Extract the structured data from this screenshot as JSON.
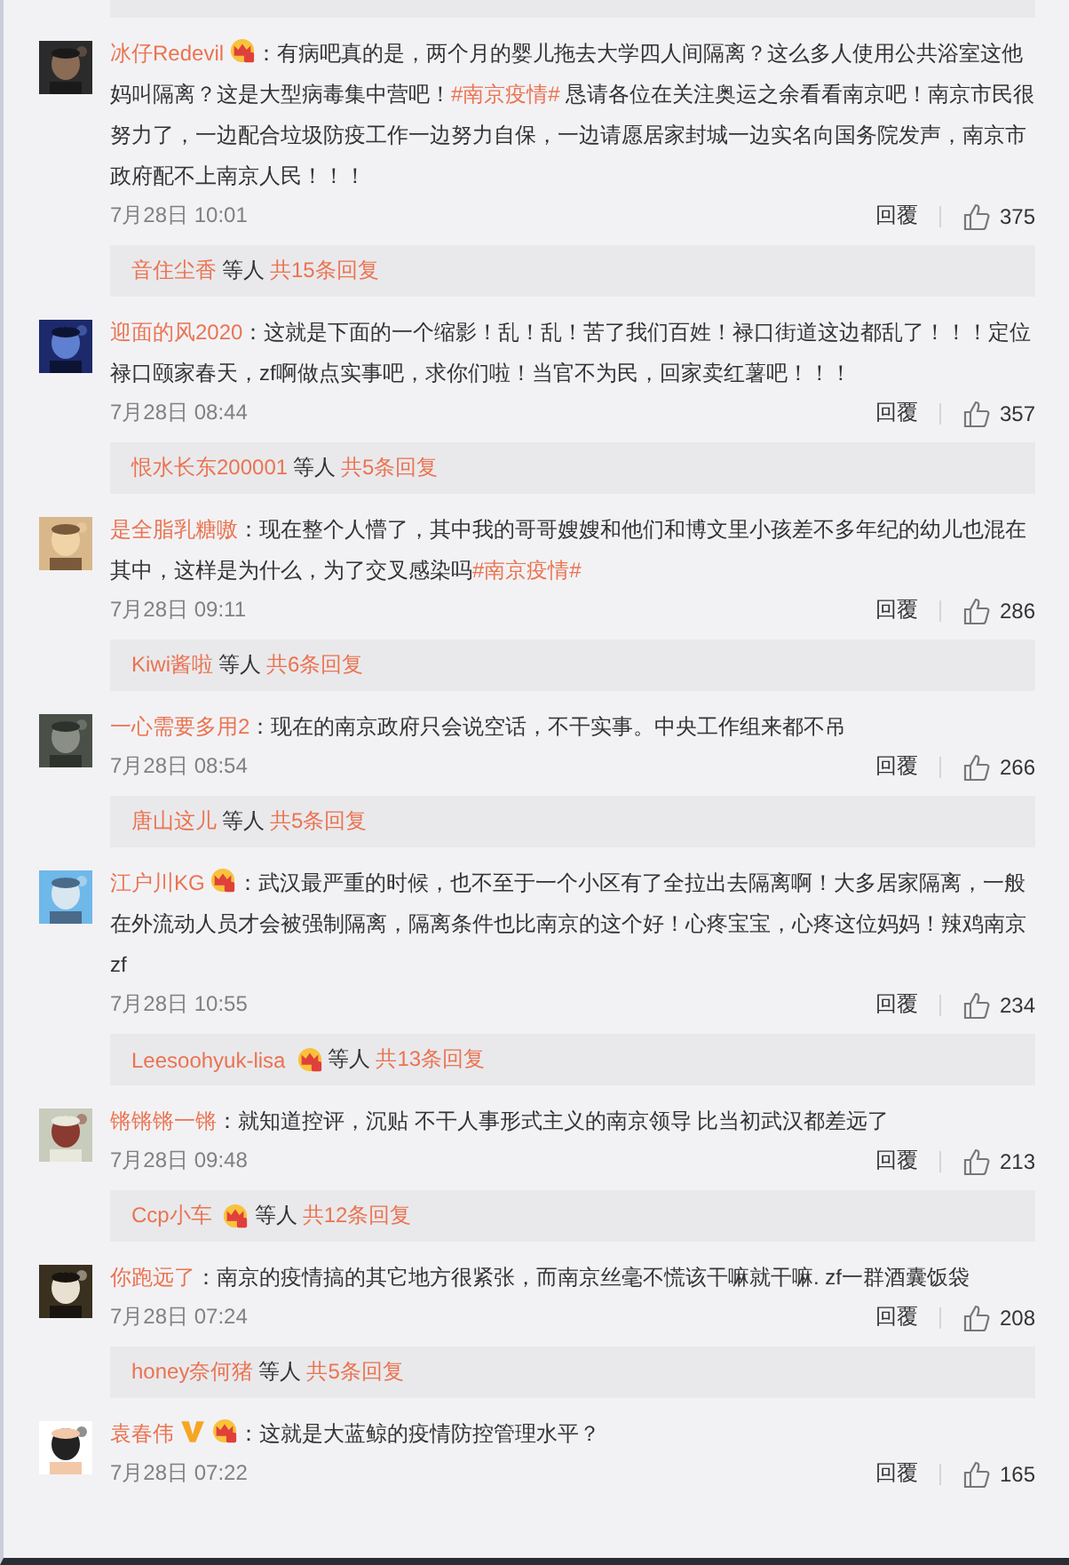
{
  "comments": [
    {
      "user": "冰仔Redevil",
      "member": true,
      "content": [
        {
          "kind": "plain",
          "text": "：有病吧真的是，两个月的婴儿拖去大学四人间隔离？这么多人使用公共浴室这他妈叫隔离？这是大型病毒集中营吧！"
        },
        {
          "kind": "topic",
          "text": "#南京疫情#"
        },
        {
          "kind": "plain",
          "text": " 恳请各位在关注奥运之余看看南京吧！南京市民很努力了，一边配合垃圾防疫工作一边努力自保，一边请愿居家封城一边实名向国务院发声，南京市政府配不上南京人民！！！"
        }
      ],
      "time": "7月28日 10:01",
      "reply_label": "回覆",
      "likes": "375",
      "replies": {
        "user": "音住尘香",
        "middle": "等人",
        "count": "共15条回复"
      }
    },
    {
      "user": "迎面的风2020",
      "content": [
        {
          "kind": "plain",
          "text": "：这就是下面的一个缩影！乱！乱！苦了我们百姓！禄口街道这边都乱了！！！定位禄口颐家春天，zf啊做点实事吧，求你们啦！当官不为民，回家卖红薯吧！！！"
        }
      ],
      "time": "7月28日 08:44",
      "reply_label": "回覆",
      "likes": "357",
      "replies": {
        "user": "恨水长东200001",
        "middle": "等人",
        "count": "共5条回复"
      }
    },
    {
      "user": "是全脂乳糖嗷",
      "content": [
        {
          "kind": "plain",
          "text": "：现在整个人懵了，其中我的哥哥嫂嫂和他们和博文里小孩差不多年纪的幼儿也混在其中，这样是为什么，为了交叉感染吗"
        },
        {
          "kind": "topic",
          "text": "#南京疫情#"
        }
      ],
      "time": "7月28日 09:11",
      "reply_label": "回覆",
      "likes": "286",
      "replies": {
        "user": "Kiwi酱啦",
        "middle": "等人",
        "count": "共6条回复"
      }
    },
    {
      "user": "一心需要多用2",
      "content": [
        {
          "kind": "plain",
          "text": "：现在的南京政府只会说空话，不干实事。中央工作组来都不吊"
        }
      ],
      "time": "7月28日 08:54",
      "reply_label": "回覆",
      "likes": "266",
      "replies": {
        "user": "唐山这儿",
        "middle": "等人",
        "count": "共5条回复"
      }
    },
    {
      "user": "江户川KG",
      "member": true,
      "content": [
        {
          "kind": "plain",
          "text": "：武汉最严重的时候，也不至于一个小区有了全拉出去隔离啊！大多居家隔离，一般在外流动人员才会被强制隔离，隔离条件也比南京的这个好！心疼宝宝，心疼这位妈妈！辣鸡南京zf"
        }
      ],
      "time": "7月28日 10:55",
      "reply_label": "回覆",
      "likes": "234",
      "replies": {
        "user": "Leesoohyuk-lisa",
        "member": true,
        "middle": "等人",
        "count": "共13条回复"
      }
    },
    {
      "user": "锵锵锵一锵",
      "content": [
        {
          "kind": "plain",
          "text": "：就知道控评，沉贴 不干人事形式主义的南京领导 比当初武汉都差远了"
        }
      ],
      "time": "7月28日 09:48",
      "reply_label": "回覆",
      "likes": "213",
      "replies": {
        "user": "Ccp小车",
        "member": true,
        "middle": "等人",
        "count": "共12条回复"
      }
    },
    {
      "user": "你跑远了",
      "content": [
        {
          "kind": "plain",
          "text": "：南京的疫情搞的其它地方很紧张，而南京丝毫不慌该干嘛就干嘛. zf一群酒囊饭袋"
        }
      ],
      "time": "7月28日 07:24",
      "reply_label": "回覆",
      "likes": "208",
      "replies": {
        "user": "honey奈何猪",
        "middle": "等人",
        "count": "共5条回复"
      }
    },
    {
      "user": "袁春伟",
      "verified": true,
      "member": true,
      "content": [
        {
          "kind": "plain",
          "text": "：这就是大蓝鲸的疫情防控管理水平？"
        }
      ],
      "time": "7月28日 07:22",
      "reply_label": "回覆",
      "likes": "165"
    }
  ]
}
